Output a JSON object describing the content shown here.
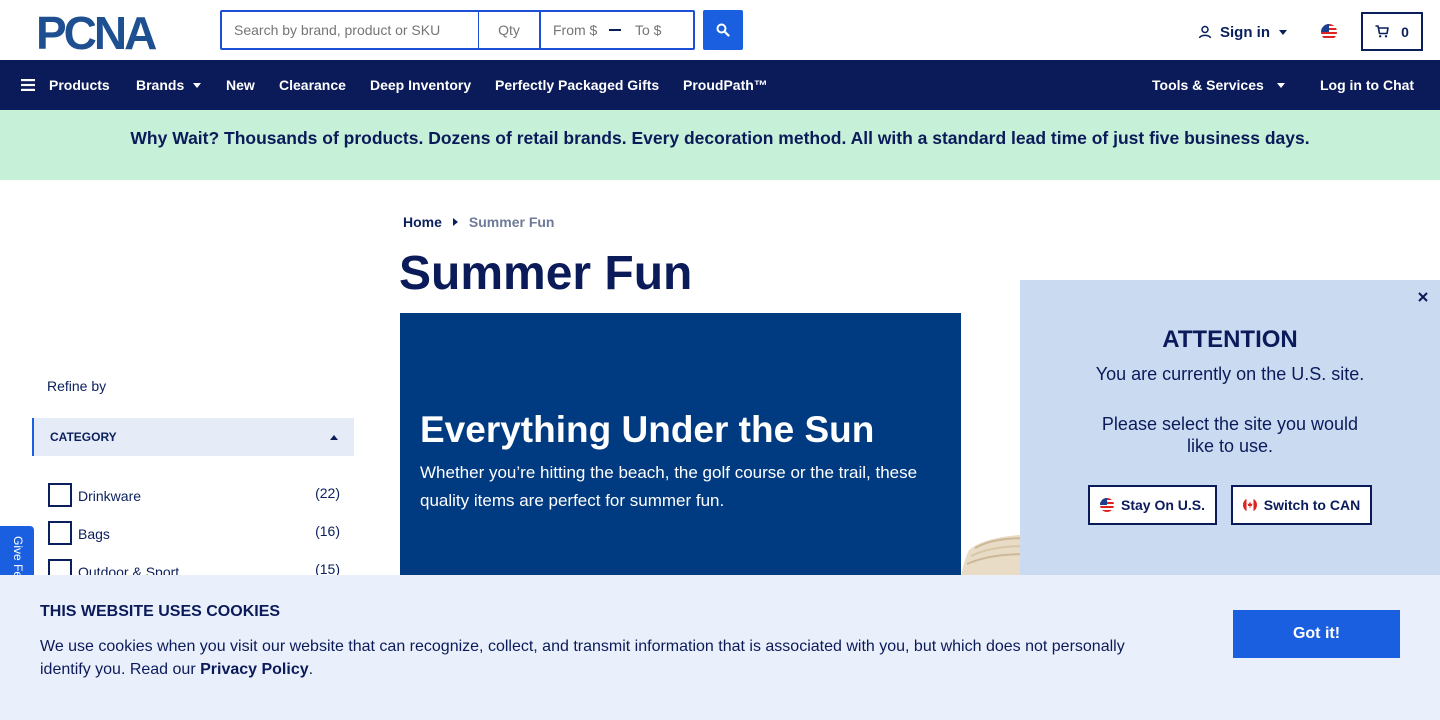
{
  "header": {
    "logo_text": "PCNA",
    "search_placeholder": "Search by brand, product or SKU",
    "qty_placeholder": "Qty",
    "price_from_placeholder": "From $",
    "price_to_placeholder": "To $",
    "signin_label": "Sign in",
    "cart_count": "0"
  },
  "nav": {
    "products": "Products",
    "brands": "Brands",
    "new": "New",
    "clearance": "Clearance",
    "deep_inventory": "Deep Inventory",
    "gifts": "Perfectly Packaged Gifts",
    "proudpath": "ProudPath™",
    "tools": "Tools & Services",
    "chat": "Log in to Chat"
  },
  "promo": {
    "text": "Why Wait? Thousands of products. Dozens of retail brands. Every decoration method. All with a standard lead time of just five business days."
  },
  "sidebar": {
    "refine_by": "Refine by",
    "category_header": "CATEGORY",
    "categories": [
      {
        "label": "Drinkware",
        "count": "(22)"
      },
      {
        "label": "Bags",
        "count": "(16)"
      },
      {
        "label": "Outdoor & Sport",
        "count": "(15)"
      }
    ]
  },
  "feedback": {
    "label": "Give Feedback"
  },
  "main": {
    "breadcrumb_home": "Home",
    "breadcrumb_current": "Summer Fun",
    "title": "Summer Fun",
    "hero_heading": "Everything Under the Sun",
    "hero_sub": "Whether you’re hitting the beach, the golf course or the trail, these quality items are perfect for summer fun."
  },
  "attention": {
    "title": "ATTENTION",
    "line1": "You are currently on the U.S. site.",
    "line2": "Please select the site you would like to use.",
    "stay_label": "Stay On U.S.",
    "switch_label": "Switch to CAN"
  },
  "cookie": {
    "title": "THIS WEBSITE USES COOKIES",
    "text": "We use cookies when you visit our website that can recognize, collect, and transmit information that is associated with you, but which does not personally identify you. Read our ",
    "link": "Privacy Policy",
    "period": ".",
    "button": "Got it!"
  },
  "colors": {
    "navy": "#0b1b5a",
    "accent_blue": "#1a5fe0",
    "promo_bg": "#c6f0d8",
    "attention_bg": "#c9daf1",
    "cookie_bg": "#eaf0fb",
    "hero_bg": "#003a80"
  }
}
